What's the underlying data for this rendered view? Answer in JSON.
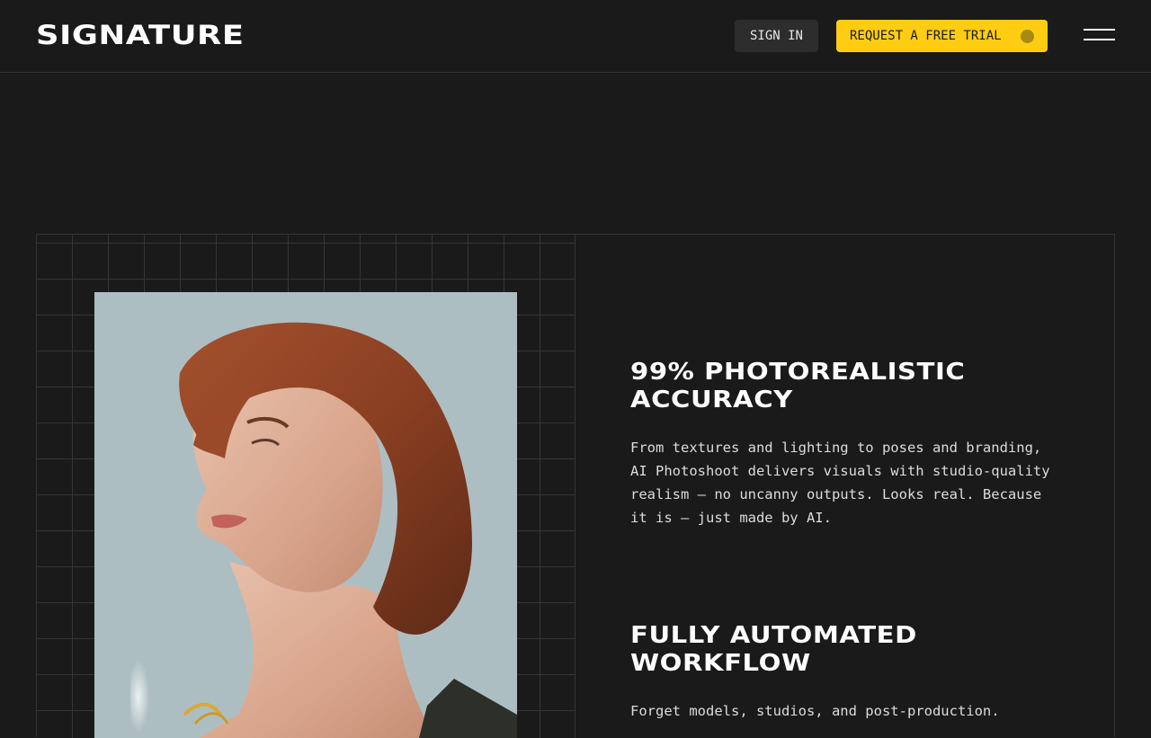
{
  "header": {
    "logo": "SIGNATURE",
    "sign_in_label": "SIGN IN",
    "trial_label": "REQUEST A FREE TRIAL",
    "trial_dot_icon": "status-dot-icon",
    "menu_icon": "hamburger-menu-icon",
    "accent_color": "#fecc11"
  },
  "features": [
    {
      "title": "99% PHOTOREALISTIC ACCURACY",
      "body": "From textures and lighting to poses and branding, AI Photoshoot delivers visuals with studio-quality realism — no uncanny outputs. Looks real. Because it is — just made by AI."
    },
    {
      "title": "FULLY AUTOMATED WORKFLOW",
      "body": "Forget models, studios, and post-production."
    }
  ],
  "colors": {
    "background": "#1a1a1a",
    "grid_line": "#353535",
    "text": "#ffffff"
  }
}
